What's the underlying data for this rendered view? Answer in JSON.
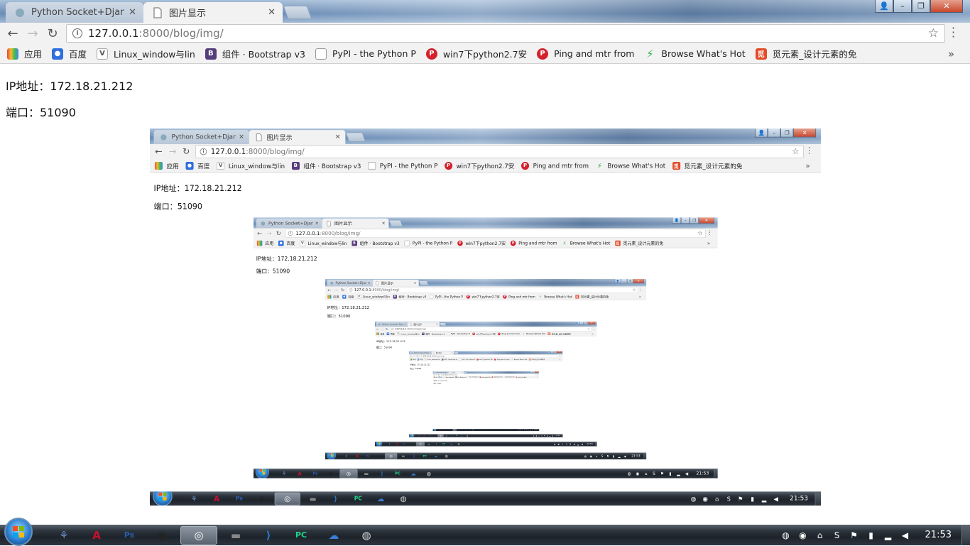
{
  "browser": {
    "tabs": [
      {
        "title": "Python Socket+Django",
        "active": false
      },
      {
        "title": "图片显示",
        "active": true
      }
    ],
    "url_host": "127.0.0.1",
    "url_path": ":8000/blog/img/",
    "bookmarks": [
      {
        "label": "应用",
        "icon": "apps-grid-icon",
        "color": "#e8453c"
      },
      {
        "label": "百度",
        "icon": "baidu-paw-icon",
        "color": "#2f6fde"
      },
      {
        "label": "Linux_window与lin",
        "icon": "bookmark-page-icon",
        "color": "#888888"
      },
      {
        "label": "组件 · Bootstrap v3",
        "icon": "bootstrap-icon",
        "color": "#563d7c"
      },
      {
        "label": "PyPI - the Python P",
        "icon": "page-icon",
        "color": "#888888"
      },
      {
        "label": "win7下python2.7安",
        "icon": "p-icon",
        "color": "#d4212d"
      },
      {
        "label": "Ping and mtr from",
        "icon": "p-icon",
        "color": "#d4212d"
      },
      {
        "label": "Browse What's Hot",
        "icon": "lightning-icon",
        "color": "#2fb24a"
      },
      {
        "label": "觅元素_设计元素的免",
        "icon": "mi-icon",
        "color": "#e34b2a"
      }
    ]
  },
  "page": {
    "ip_label": "IP地址：172.18.21.212",
    "port_label": "端口：51090"
  },
  "taskbar": {
    "clock": "21:53",
    "apps": [
      {
        "name": "people-icon",
        "glyph": "⚘"
      },
      {
        "name": "acrobat-icon",
        "glyph": "A"
      },
      {
        "name": "photoshop-icon",
        "glyph": "Ps"
      },
      {
        "name": "qq-icon",
        "glyph": "◉"
      },
      {
        "name": "chrome-icon",
        "glyph": "◎"
      },
      {
        "name": "terminal-icon",
        "glyph": "▬"
      },
      {
        "name": "vscode-icon",
        "glyph": "⟩"
      },
      {
        "name": "pycharm-icon",
        "glyph": "PC"
      },
      {
        "name": "baidu-netdisk-icon",
        "glyph": "☁"
      },
      {
        "name": "media-icon",
        "glyph": "◍"
      }
    ],
    "tray": [
      "globe-icon",
      "qq-tray-icon",
      "network-icon",
      "sogou-icon",
      "flag-icon",
      "usb-icon",
      "signal-icon",
      "volume-icon"
    ]
  }
}
